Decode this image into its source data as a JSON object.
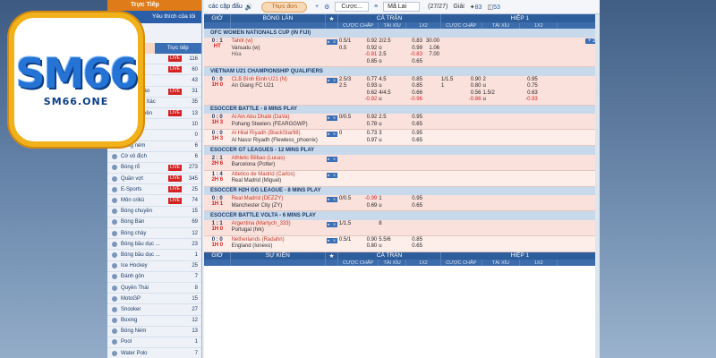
{
  "logo": {
    "mark": "SM66",
    "domain": "SM66.ONE"
  },
  "sidebar": {
    "tab_live": "Trực Tiếp",
    "favorites": "Yêu thích của tôi",
    "sub_today": "Hôm nay",
    "sub_live": "Trực tiếp",
    "items": [
      {
        "label": "Bóng đá",
        "live": "LIVE",
        "count": "116"
      },
      {
        "label": "Bóng rổ",
        "live": "LIVE",
        "count": "60"
      },
      {
        "label": "Tennis",
        "live": "",
        "count": "43"
      },
      {
        "label": "Thể thao ảo",
        "live": "LIVE",
        "count": "31"
      },
      {
        "label": "Đua ngựa Xác",
        "live": "",
        "count": "35"
      },
      {
        "label": "Bóng chuyền",
        "live": "LIVE",
        "count": "13"
      },
      {
        "label": "Bắn cá",
        "live": "",
        "count": "10"
      },
      {
        "label": "Esports",
        "live": "",
        "count": "0"
      },
      {
        "label": "Bóng ném",
        "live": "",
        "count": "6"
      },
      {
        "label": "Cờ vô địch",
        "live": "",
        "count": "6"
      },
      {
        "label": "Bóng rổ",
        "live": "LIVE",
        "count": "273"
      },
      {
        "label": "Quần vợt",
        "live": "LIVE",
        "count": "345"
      },
      {
        "label": "E-Sports",
        "live": "LIVE",
        "count": "25"
      },
      {
        "label": "Môn crikü",
        "live": "LIVE",
        "count": "74"
      },
      {
        "label": "Bóng chuyền",
        "live": "",
        "count": "15"
      },
      {
        "label": "Bóng Bàn",
        "live": "",
        "count": "69"
      },
      {
        "label": "Bóng chày",
        "live": "",
        "count": "12"
      },
      {
        "label": "Bóng bầu dục ...",
        "live": "",
        "count": "23"
      },
      {
        "label": "Bóng bầu dục ...",
        "live": "",
        "count": "1"
      },
      {
        "label": "Ice Hockey",
        "live": "",
        "count": "25"
      },
      {
        "label": "Đánh gôn",
        "live": "",
        "count": "7"
      },
      {
        "label": "Quyền Thái",
        "live": "",
        "count": "8"
      },
      {
        "label": "MotoGP",
        "live": "",
        "count": "15"
      },
      {
        "label": "Snooker",
        "live": "",
        "count": "27"
      },
      {
        "label": "Boxing",
        "live": "",
        "count": "12"
      },
      {
        "label": "Bóng Ném",
        "live": "",
        "count": "13"
      },
      {
        "label": "Pool",
        "live": "",
        "count": "1"
      },
      {
        "label": "Water Polo",
        "live": "",
        "count": "7"
      },
      {
        "label": "Bóng gậy",
        "live": "",
        "count": "1"
      }
    ]
  },
  "topbar": {
    "caption": "các cặp đấu",
    "menu": "Thực đơn",
    "odds_select": "Cược...",
    "odds_type": "Mã Lai",
    "count": "(27/27)",
    "giai": "Giải",
    "stat1": "83",
    "stat2": "53"
  },
  "header": {
    "time": "GIỜ",
    "matches": "BÓNG LĂN",
    "full": "CẢ TRẬN",
    "half": "HIỆP 1",
    "hc": "CƯỢC CHẤP",
    "ou": "TÀI XỈU",
    "x12": "1X2",
    "event": "SỰ KIỆN"
  },
  "leagues": [
    {
      "name": "OFC WOMEN NATIONALS CUP (IN FIJI)",
      "matches": [
        {
          "score": "0 : 1",
          "time": "HT",
          "home": "Tahiti (w)",
          "away": "Vanuatu (w)",
          "draw": "Hòa",
          "hc": [
            "",
            "0.5/1",
            "",
            "0.5"
          ],
          "hc_odds": [
            "0.92",
            "0.92",
            "-0.81",
            "0.85"
          ],
          "ou": [
            "2/2.5",
            "o",
            "2.5",
            "o"
          ],
          "ou_odds": [
            "0.83",
            "0.99",
            "-0.83",
            "0.65"
          ],
          "x12": [
            "30.00",
            "1.06",
            "7.00"
          ],
          "plus": "+ 2"
        }
      ]
    },
    {
      "name": "VIETNAM U21 CHAMPIONSHIP QUALIFIERS",
      "matches": [
        {
          "score": "0 : 0",
          "time": "1H 0",
          "home": "CLB Bình Định U21 (N)",
          "away": "An Giang FC U21",
          "draw": "",
          "hc": [
            "2.5/3",
            "",
            "2.5",
            ""
          ],
          "hc_odds": [
            "0.77",
            "0.93",
            "0.62",
            "-0.92"
          ],
          "ou": [
            "4.5",
            "u",
            "4/4.5",
            "u"
          ],
          "ou_odds": [
            "0.85",
            "0.85",
            "0.66",
            "-0.96"
          ],
          "h_hc": [
            "1/1.5",
            "",
            "1",
            ""
          ],
          "h_hc_odds": [
            "0.90",
            "0.80",
            "0.56",
            "-0.86"
          ],
          "h_ou": [
            "2",
            "u",
            "1.5/2",
            "u"
          ],
          "h_ou_odds": [
            "0.95",
            "0.75",
            "0.63",
            "-0.93"
          ]
        }
      ]
    },
    {
      "name": "ESOCCER BATTLE - 8 MINS PLAY",
      "matches": [
        {
          "score": "0 : 0",
          "time": "1H 3",
          "home": "Al Ain Abu Dhabi (DaVa)",
          "away": "Pohang Steelers (FEARGGWP)",
          "hc": [
            "",
            "0/0.5"
          ],
          "hc_odds": [
            "0.92",
            "0.78"
          ],
          "ou": [
            "2.5",
            "u"
          ],
          "ou_odds": [
            "0.95",
            "0.65"
          ]
        },
        {
          "score": "0 : 0",
          "time": "1H 3",
          "home": "Al Hilal Riyadh (BlackStar98)",
          "away": "Al Nassr Riyadh (Flewless_phoenix)",
          "hc": [
            "0",
            ""
          ],
          "hc_odds": [
            "0.73",
            "0.97"
          ],
          "ou": [
            "3",
            "u"
          ],
          "ou_odds": [
            "0.95",
            "0.65"
          ]
        }
      ]
    },
    {
      "name": "ESOCCER GT LEAGUES - 12 MINS PLAY",
      "matches": [
        {
          "score": "2 : 1",
          "time": "2H 6",
          "home": "Athletic Bilbao (Lucas)",
          "away": "Barcelona (Potter)"
        },
        {
          "score": "1 : 4",
          "time": "2H 6",
          "home": "Atletico de Madrid (Carlos)",
          "away": "Real Madrid (Miguel)"
        }
      ]
    },
    {
      "name": "ESOCCER H2H GG LEAGUE - 8 MINS PLAY",
      "matches": [
        {
          "score": "0 : 0",
          "time": "1H 1",
          "home": "Real Madrid (DEZZY)",
          "away": "Manchester City (ZY)",
          "hc": [
            "0/0.5",
            ""
          ],
          "hc_odds": [
            "-0.99",
            "0.69"
          ],
          "ou": [
            "1",
            "u"
          ],
          "ou_odds": [
            "0.95",
            "0.65"
          ]
        }
      ]
    },
    {
      "name": "ESOCCER BATTLE VOLTA - 6 MINS PLAY",
      "matches": [
        {
          "score": "1 : 1",
          "time": "1H 0",
          "home": "Argentina (Martych_333)",
          "away": "Portugal (hrk)",
          "hc": [
            "1/1.5",
            ""
          ],
          "hc_odds": [
            "",
            ""
          ],
          "ou": [
            "8",
            ""
          ],
          "ou_odds": [
            "",
            ""
          ]
        },
        {
          "score": "0 : 0",
          "time": "1H 0",
          "home": "Netherlands (Radahn)",
          "away": "England (Ionexo)",
          "hc": [
            "",
            "0.5/1"
          ],
          "hc_odds": [
            "0.90",
            "0.80"
          ],
          "ou": [
            "5.5/6",
            "u"
          ],
          "ou_odds": [
            "0.85",
            "0.65"
          ]
        }
      ]
    }
  ]
}
